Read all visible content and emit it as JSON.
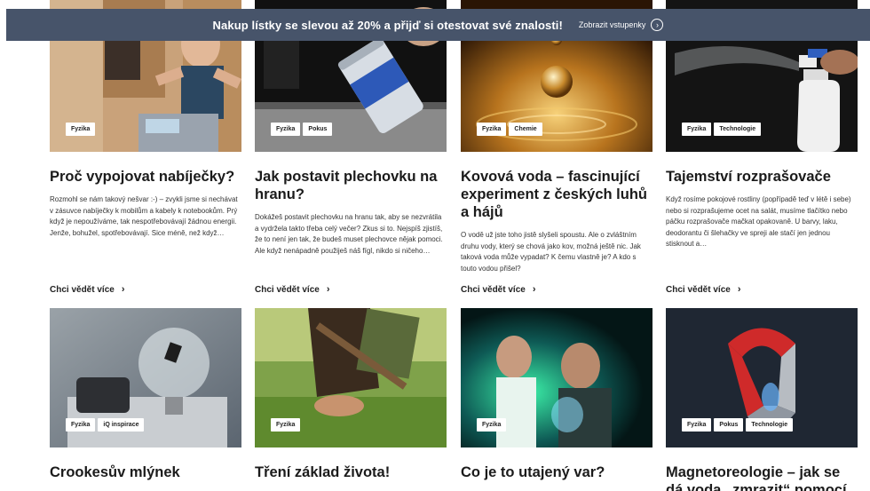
{
  "banner": {
    "text": "Nakup lístky se slevou až 20% a přijď si otestovat své znalosti!",
    "link": "Zobrazit vstupenky",
    "icon": "chevron-right-circle-icon"
  },
  "read_more": "Chci vědět více",
  "cards": [
    {
      "tags": [
        "Fyzika"
      ],
      "title": "Proč vypojovat nabíječky?",
      "excerpt": "Rozmohl se nám takový nešvar :-) – zvykli jsme si nechávat v zásuvce nabíječky k mobilům a kabely k notebookům. Prý když je nepoužíváme, tak nespotřebovávají žádnou energii. Jenže, bohužel, spotřebovávají. Sice méně, než když…"
    },
    {
      "tags": [
        "Fyzika",
        "Pokus"
      ],
      "title": "Jak postavit plechovku na hranu?",
      "excerpt": "Dokážeš postavit plechovku na hranu tak, aby se nezvrátila a vydržela takto třeba celý večer? Zkus si to. Nejspíš zjistíš, že to není jen tak, že budeš muset plechovce nějak pomoci. Ale když nenápadně použiješ náš fígl, nikdo si ničeho…"
    },
    {
      "tags": [
        "Fyzika",
        "Chemie"
      ],
      "title": "Kovová voda – fascinující experiment z českých luhů a hájů",
      "excerpt": "O vodě už jste toho jistě slyšeli spoustu. Ale o zvláštním druhu vody, který se chová jako kov, možná ještě nic. Jak taková voda může vypadat? K čemu vlastně je? A kdo s touto vodou přišel?"
    },
    {
      "tags": [
        "Fyzika",
        "Technologie"
      ],
      "title": "Tajemství rozprašovače",
      "excerpt": "Když rosíme pokojové rostliny (popřípadě teď v létě i sebe) nebo si rozprašujeme ocet na salát, musíme tlačítko nebo páčku rozprašovače mačkat opakovaně. U barvy, laku, deodorantu či šlehačky ve spreji ale stačí jen jednou stisknout a…"
    },
    {
      "tags": [
        "Fyzika",
        "iQ inspirace"
      ],
      "title": "Crookesův mlýnek",
      "excerpt": ""
    },
    {
      "tags": [
        "Fyzika"
      ],
      "title": "Tření základ života!",
      "excerpt": ""
    },
    {
      "tags": [
        "Fyzika"
      ],
      "title": "Co je to utajený var?",
      "excerpt": ""
    },
    {
      "tags": [
        "Fyzika",
        "Pokus",
        "Technologie"
      ],
      "title": "Magnetoreologie – jak se dá voda „zmrazit“ pomocí",
      "excerpt": ""
    }
  ]
}
